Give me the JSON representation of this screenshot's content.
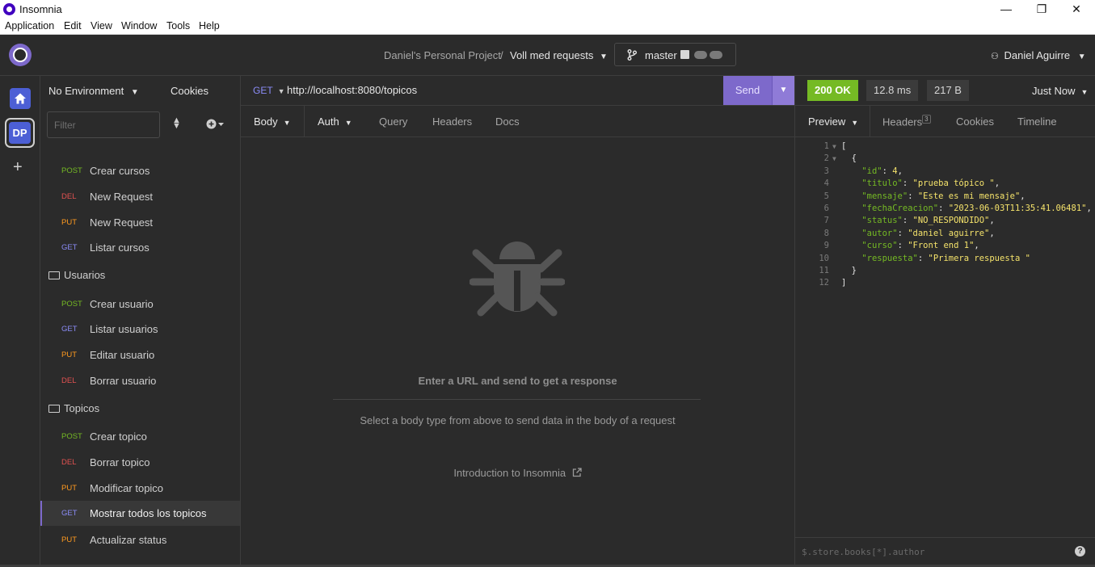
{
  "window": {
    "title": "Insomnia",
    "controls": [
      "—",
      "❐",
      "✕"
    ]
  },
  "menu": [
    "Application",
    "Edit",
    "View",
    "Window",
    "Tools",
    "Help"
  ],
  "header": {
    "project": "Daniel's Personal Project",
    "separator": "/",
    "collection": "Voll med requests",
    "branch": "master",
    "user": "Daniel Aguirre"
  },
  "rail": {
    "workspace_badge": "DP",
    "add": "+"
  },
  "sidebar": {
    "environment": "No Environment",
    "cookies": "Cookies",
    "filter_placeholder": "Filter",
    "items": [
      {
        "method": "POST",
        "name": "Crear cursos"
      },
      {
        "method": "DEL",
        "name": "New Request"
      },
      {
        "method": "PUT",
        "name": "New Request"
      },
      {
        "method": "GET",
        "name": "Listar cursos"
      }
    ],
    "folders": [
      {
        "name": "Usuarios",
        "items": [
          {
            "method": "POST",
            "name": "Crear usuario"
          },
          {
            "method": "GET",
            "name": "Listar usuarios"
          },
          {
            "method": "PUT",
            "name": "Editar usuario"
          },
          {
            "method": "DEL",
            "name": "Borrar usuario"
          }
        ]
      },
      {
        "name": "Topicos",
        "items": [
          {
            "method": "POST",
            "name": "Crear topico"
          },
          {
            "method": "DEL",
            "name": "Borrar topico"
          },
          {
            "method": "PUT",
            "name": "Modificar topico"
          },
          {
            "method": "GET",
            "name": "Mostrar todos los topicos",
            "active": true
          },
          {
            "method": "PUT",
            "name": "Actualizar status"
          }
        ]
      }
    ]
  },
  "request": {
    "method": "GET",
    "url": "http://localhost:8080/topicos",
    "send": "Send",
    "tabs": [
      "Body",
      "Auth",
      "Query",
      "Headers",
      "Docs"
    ],
    "empty_title": "Enter a URL and send to get a response",
    "empty_body": "Select a body type from above to send data in the body of a request",
    "intro_link": "Introduction to Insomnia"
  },
  "response": {
    "status": "200 OK",
    "time": "12.8 ms",
    "size": "217 B",
    "when": "Just Now",
    "tabs": {
      "preview": "Preview",
      "headers": "Headers",
      "headers_count": "3",
      "cookies": "Cookies",
      "timeline": "Timeline"
    },
    "json_lines": [
      "[",
      "  {",
      "    \"id\": 4,",
      "    \"titulo\": \"prueba tópico \",",
      "    \"mensaje\": \"Este es mi mensaje\",",
      "    \"fechaCreacion\": \"2023-06-03T11:35:41.06481\",",
      "    \"status\": \"NO_RESPONDIDO\",",
      "    \"autor\": \"daniel aguirre\",",
      "    \"curso\": \"Front end 1\",",
      "    \"respuesta\": \"Primera respuesta \"",
      "  }",
      "]"
    ],
    "filter_placeholder": "$.store.books[*].author",
    "help": "?"
  },
  "colors": {
    "accent": "#7d69cb",
    "post": "#75ba24",
    "del": "#e15251",
    "put": "#ff9a1f",
    "get": "#8b8cf7",
    "ok": "#75ba24"
  }
}
